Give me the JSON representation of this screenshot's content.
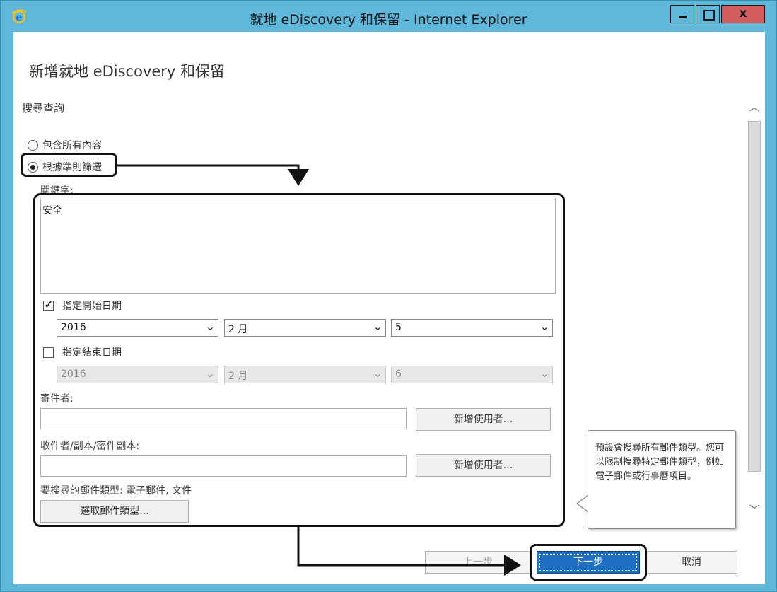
{
  "window": {
    "title": "就地 eDiscovery 和保留 - Internet Explorer",
    "close_glyph": "x"
  },
  "page": {
    "title": "新增就地 eDiscovery 和保留",
    "section": "搜尋查詢"
  },
  "scope": {
    "option_all": "包含所有內容",
    "option_filter": "根據準則篩選",
    "selected": "option_filter"
  },
  "keywords": {
    "label": "關鍵字:",
    "value": "安全"
  },
  "start_date": {
    "label": "指定開始日期",
    "checked": true,
    "year": "2016",
    "month": "2 月",
    "day": "5"
  },
  "end_date": {
    "label": "指定結束日期",
    "checked": false,
    "year": "2016",
    "month": "2 月",
    "day": "6"
  },
  "sender": {
    "label": "寄件者:",
    "value": "",
    "add_button": "新增使用者..."
  },
  "recipients": {
    "label": "收件者/副本/密件副本:",
    "value": "",
    "add_button": "新增使用者..."
  },
  "message_types": {
    "label": "要搜尋的郵件類型: 電子郵件, 文件",
    "select_button": "選取郵件類型..."
  },
  "tooltip": {
    "text": "預設會搜尋所有郵件類型。您可以限制搜尋特定郵件類型，例如電子郵件或行事曆項目。"
  },
  "nav": {
    "prev": "上一步",
    "next": "下一步",
    "cancel": "取消"
  },
  "scrollbar": {
    "up_glyph": "︿",
    "down_glyph": "﹀"
  },
  "colors": {
    "title_bar": "#5fb8d9",
    "primary_button": "#1f6fc4",
    "close_button": "#d35d5d"
  }
}
